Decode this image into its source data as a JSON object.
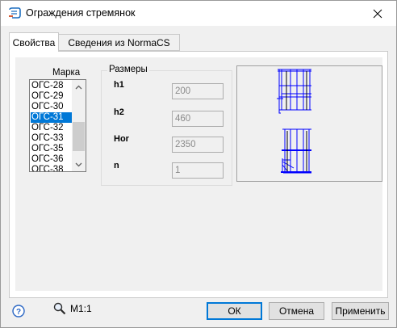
{
  "window": {
    "title": "Ограждения стремянок"
  },
  "tabs": [
    {
      "label": "Свойства",
      "active": true
    },
    {
      "label": "Сведения из NormaCS",
      "active": false
    }
  ],
  "marka": {
    "label": "Марка",
    "items": [
      "ОГС-28",
      "ОГС-29",
      "ОГС-30",
      "ОГС-31",
      "ОГС-32",
      "ОГС-33",
      "ОГС-35",
      "ОГС-36",
      "ОГС-38"
    ],
    "selected": "ОГС-31"
  },
  "dimensions": {
    "title": "Размеры",
    "params": [
      {
        "label": "h1",
        "value": "200"
      },
      {
        "label": "h2",
        "value": "460"
      },
      {
        "label": "Hor",
        "value": "2350"
      },
      {
        "label": "n",
        "value": "1"
      }
    ]
  },
  "footer": {
    "scale_label": "М1:1",
    "ok_label": "ОК",
    "cancel_label": "Отмена",
    "apply_label": "Применить"
  },
  "colors": {
    "accent": "#0078d7",
    "drawing_blue": "#0000ff",
    "dialog_bg": "#f0f0f0"
  },
  "icons": {
    "app": "app-icon",
    "close": "close-icon",
    "help": "help-icon",
    "zoom": "magnifier-icon"
  }
}
